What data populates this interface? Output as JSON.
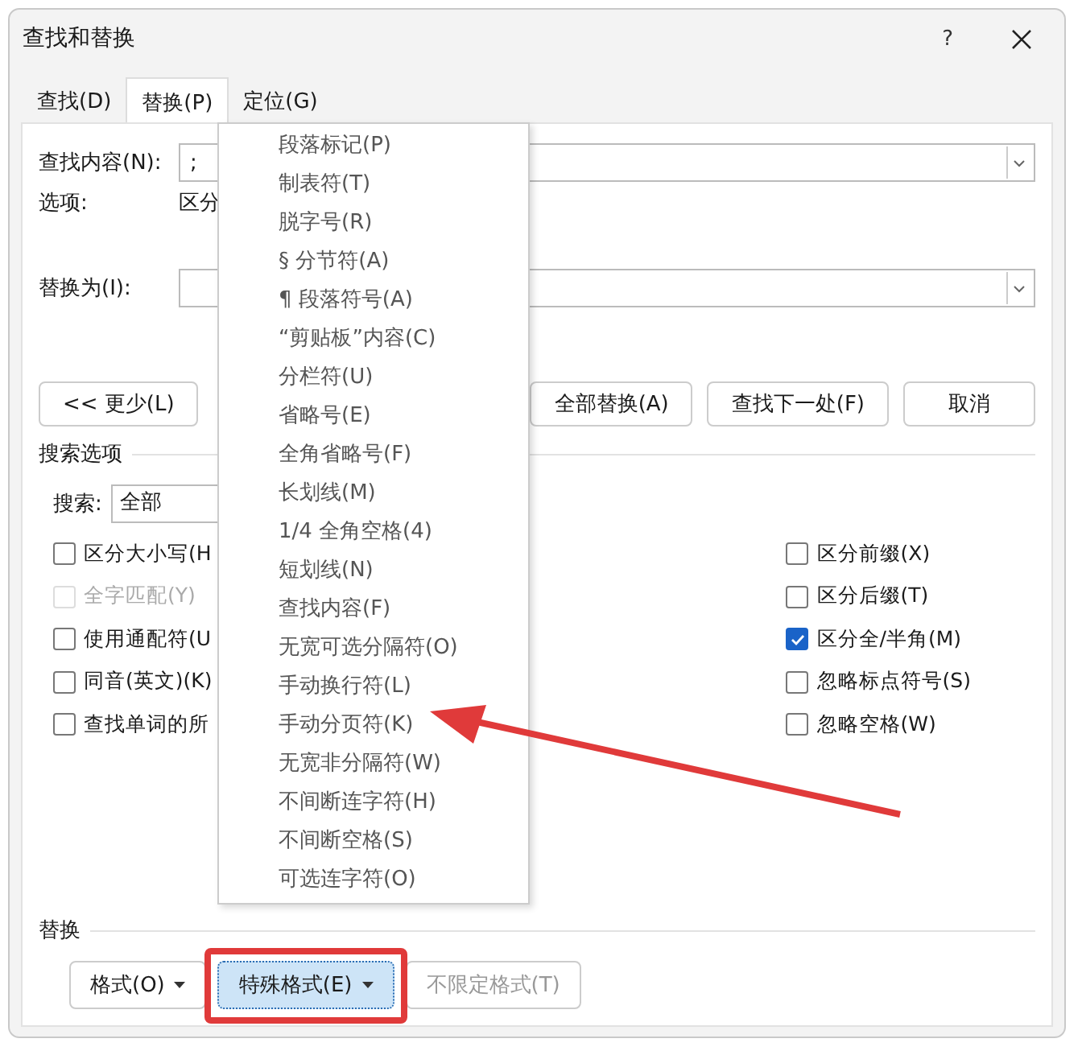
{
  "window": {
    "title": "查找和替换",
    "help": "?"
  },
  "tabs": [
    {
      "label": "查找(D)",
      "selected": false
    },
    {
      "label": "替换(P)",
      "selected": true
    },
    {
      "label": "定位(G)",
      "selected": false
    }
  ],
  "find": {
    "label": "查找内容(N):",
    "value": ";"
  },
  "options": {
    "label": "选项:",
    "value": "区分"
  },
  "replace": {
    "label": "替换为(I):"
  },
  "buttons": [
    {
      "label": "<< 更少(L)",
      "kind": "left"
    },
    {
      "label": "全部替换(A)",
      "kind": "right"
    },
    {
      "label": "查找下一处(F)",
      "kind": "right"
    },
    {
      "label": "取消",
      "kind": "right"
    }
  ],
  "search_options": {
    "title": "搜索选项",
    "search_label": "搜索:",
    "search_value": "全部",
    "left": [
      {
        "label": "区分大小写(H",
        "checked": false,
        "disabled": false
      },
      {
        "label": "全字匹配(Y)",
        "checked": false,
        "disabled": true
      },
      {
        "label": "使用通配符(U",
        "checked": false,
        "disabled": false
      },
      {
        "label": "同音(英文)(K)",
        "checked": false,
        "disabled": false
      },
      {
        "label": "查找单词的所",
        "checked": false,
        "disabled": false
      }
    ],
    "right": [
      {
        "label": "区分前缀(X)",
        "checked": false,
        "disabled": false
      },
      {
        "label": "区分后缀(T)",
        "checked": false,
        "disabled": false
      },
      {
        "label": "区分全/半角(M)",
        "checked": true,
        "disabled": false
      },
      {
        "label": "忽略标点符号(S)",
        "checked": false,
        "disabled": false
      },
      {
        "label": "忽略空格(W)",
        "checked": false,
        "disabled": false
      }
    ]
  },
  "replace_section": {
    "title": "替换",
    "buttons": [
      {
        "label": "格式(O)",
        "dropdown": true,
        "active": false,
        "disabled": false
      },
      {
        "label": "特殊格式(E)",
        "dropdown": true,
        "active": true,
        "disabled": false
      },
      {
        "label": "不限定格式(T)",
        "dropdown": false,
        "active": false,
        "disabled": true
      }
    ]
  },
  "special_menu": {
    "items": [
      "段落标记(P)",
      "制表符(T)",
      "脱字号(R)",
      "§ 分节符(A)",
      "¶ 段落符号(A)",
      "“剪贴板”内容(C)",
      "分栏符(U)",
      "省略号(E)",
      "全角省略号(F)",
      "长划线(M)",
      "1/4 全角空格(4)",
      "短划线(N)",
      "查找内容(F)",
      "无宽可选分隔符(O)",
      "手动换行符(L)",
      "手动分页符(K)",
      "无宽非分隔符(W)",
      "不间断连字符(H)",
      "不间断空格(S)",
      "可选连字符(O)"
    ]
  }
}
